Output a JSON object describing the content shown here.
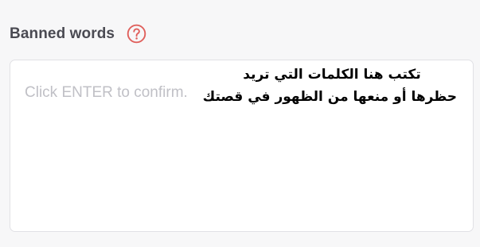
{
  "field": {
    "label": "Banned words",
    "help_icon": "question-circle-icon",
    "help_icon_color": "#e0605c",
    "placeholder": "Click ENTER to confirm.",
    "value": ""
  },
  "overlay": {
    "lines": [
      "تكتب هنا الكلمات التي تريد",
      "حظرها أو منعها من الظهور في قصتك"
    ]
  }
}
